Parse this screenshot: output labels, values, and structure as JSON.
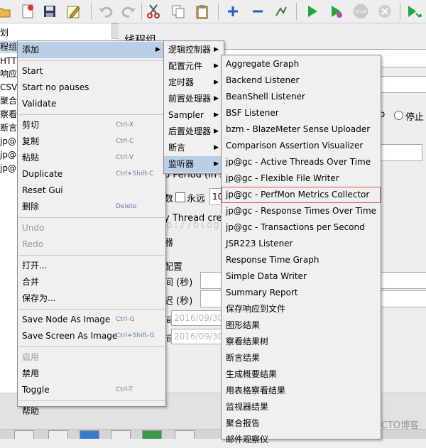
{
  "app": {
    "accent": "#b8cfe5",
    "selection_outline": "#d9534f"
  },
  "toolbar": {
    "buttons": [
      {
        "icon": "open-folder-icon"
      },
      {
        "icon": "close-file-icon"
      },
      {
        "icon": "save-icon"
      },
      {
        "icon": "edit-icon"
      },
      {
        "icon": "undo-icon"
      },
      {
        "icon": "redo-icon"
      },
      {
        "icon": "cut-icon"
      },
      {
        "icon": "copy-icon"
      },
      {
        "icon": "paste-icon"
      },
      {
        "icon": "expand-icon"
      },
      {
        "icon": "collapse-icon"
      },
      {
        "icon": "toggle-icon"
      },
      {
        "icon": "start-icon"
      },
      {
        "icon": "start-no-pauses-icon"
      },
      {
        "icon": "stop-icon"
      },
      {
        "icon": "shutdown-icon"
      },
      {
        "icon": "remote-start-icon"
      }
    ],
    "stop_label": "STOP"
  },
  "tree": {
    "items": [
      "划",
      "程组--",
      "HTT",
      "响应",
      "CSV",
      "聚合",
      "察看",
      "断言",
      "jp@",
      "jp@",
      "jp@"
    ]
  },
  "panel": {
    "title": "线程组",
    "radio_stop": "停止",
    "p_suffix": "p",
    "ramp_label": "p Period (in se",
    "loop_prefix": "数",
    "forever_label": "永远",
    "loop_value": "10",
    "thread_label": "y Thread crea",
    "scheduler_label": "器",
    "config_label": "配置",
    "duration_label": "间 (秒)",
    "delay_label": "迟 (秒)",
    "start_time_prefix": "间",
    "end_time_prefix": "间",
    "start_time": "2016/09/30",
    "end_time": "2016/09/30"
  },
  "watermark": "http://blog.csdn.net/",
  "brand": "@51CTO博客",
  "menus": {
    "main": [
      {
        "label": "添加",
        "submenu": true,
        "highlight": true
      },
      {
        "sep": true
      },
      {
        "label": "Start"
      },
      {
        "label": "Start no pauses"
      },
      {
        "label": "Validate"
      },
      {
        "sep": true
      },
      {
        "label": "剪切",
        "shortcut": "Ctrl-X"
      },
      {
        "label": "复制",
        "shortcut": "Ctrl-C"
      },
      {
        "label": "粘贴",
        "shortcut": "Ctrl-V"
      },
      {
        "label": "Duplicate",
        "shortcut": "Ctrl+Shift-C"
      },
      {
        "label": "Reset Gui"
      },
      {
        "label": "删除",
        "shortcut": "Delete"
      },
      {
        "sep": true
      },
      {
        "label": "Undo",
        "disabled": true
      },
      {
        "label": "Redo",
        "disabled": true
      },
      {
        "sep": true
      },
      {
        "label": "打开..."
      },
      {
        "label": "合并"
      },
      {
        "label": "保存为..."
      },
      {
        "sep": true
      },
      {
        "label": "Save Node As Image",
        "shortcut": "Ctrl-G"
      },
      {
        "label": "Save Screen As Image",
        "shortcut": "Ctrl+Shift-G"
      },
      {
        "sep": true
      },
      {
        "label": "启用",
        "disabled": true
      },
      {
        "label": "禁用"
      },
      {
        "label": "Toggle",
        "shortcut": "Ctrl-T"
      },
      {
        "sep": true
      },
      {
        "label": "帮助"
      }
    ],
    "add": [
      {
        "label": "逻辑控制器",
        "submenu": true
      },
      {
        "label": "配置元件",
        "submenu": true
      },
      {
        "label": "定时器",
        "submenu": true
      },
      {
        "label": "前置处理器",
        "submenu": true
      },
      {
        "label": "Sampler",
        "submenu": true
      },
      {
        "label": "后置处理器",
        "submenu": true
      },
      {
        "label": "断言",
        "submenu": true
      },
      {
        "label": "监听器",
        "submenu": true,
        "highlight": true
      }
    ],
    "listeners": [
      {
        "label": "Aggregate Graph"
      },
      {
        "label": "Backend Listener"
      },
      {
        "label": "BeanShell Listener"
      },
      {
        "label": "BSF Listener"
      },
      {
        "label": "bzm - BlazeMeter Sense Uploader"
      },
      {
        "label": "Comparison Assertion Visualizer"
      },
      {
        "label": "jp@gc - Active Threads Over Time"
      },
      {
        "label": "jp@gc - Flexible File Writer"
      },
      {
        "label": "jp@gc - PerfMon Metrics Collector",
        "outlined": true
      },
      {
        "label": "jp@gc - Response Times Over Time"
      },
      {
        "label": "jp@gc - Transactions per Second"
      },
      {
        "label": "JSR223 Listener"
      },
      {
        "label": "Response Time Graph"
      },
      {
        "label": "Simple Data Writer"
      },
      {
        "label": "Summary Report"
      },
      {
        "label": "保存响应到文件"
      },
      {
        "label": "图形结果"
      },
      {
        "label": "察看结果树"
      },
      {
        "label": "断言结果"
      },
      {
        "label": "生成概要结果"
      },
      {
        "label": "用表格察看结果"
      },
      {
        "label": "监视器结果"
      },
      {
        "label": "聚合报告"
      },
      {
        "label": "邮件观察仪"
      }
    ]
  }
}
